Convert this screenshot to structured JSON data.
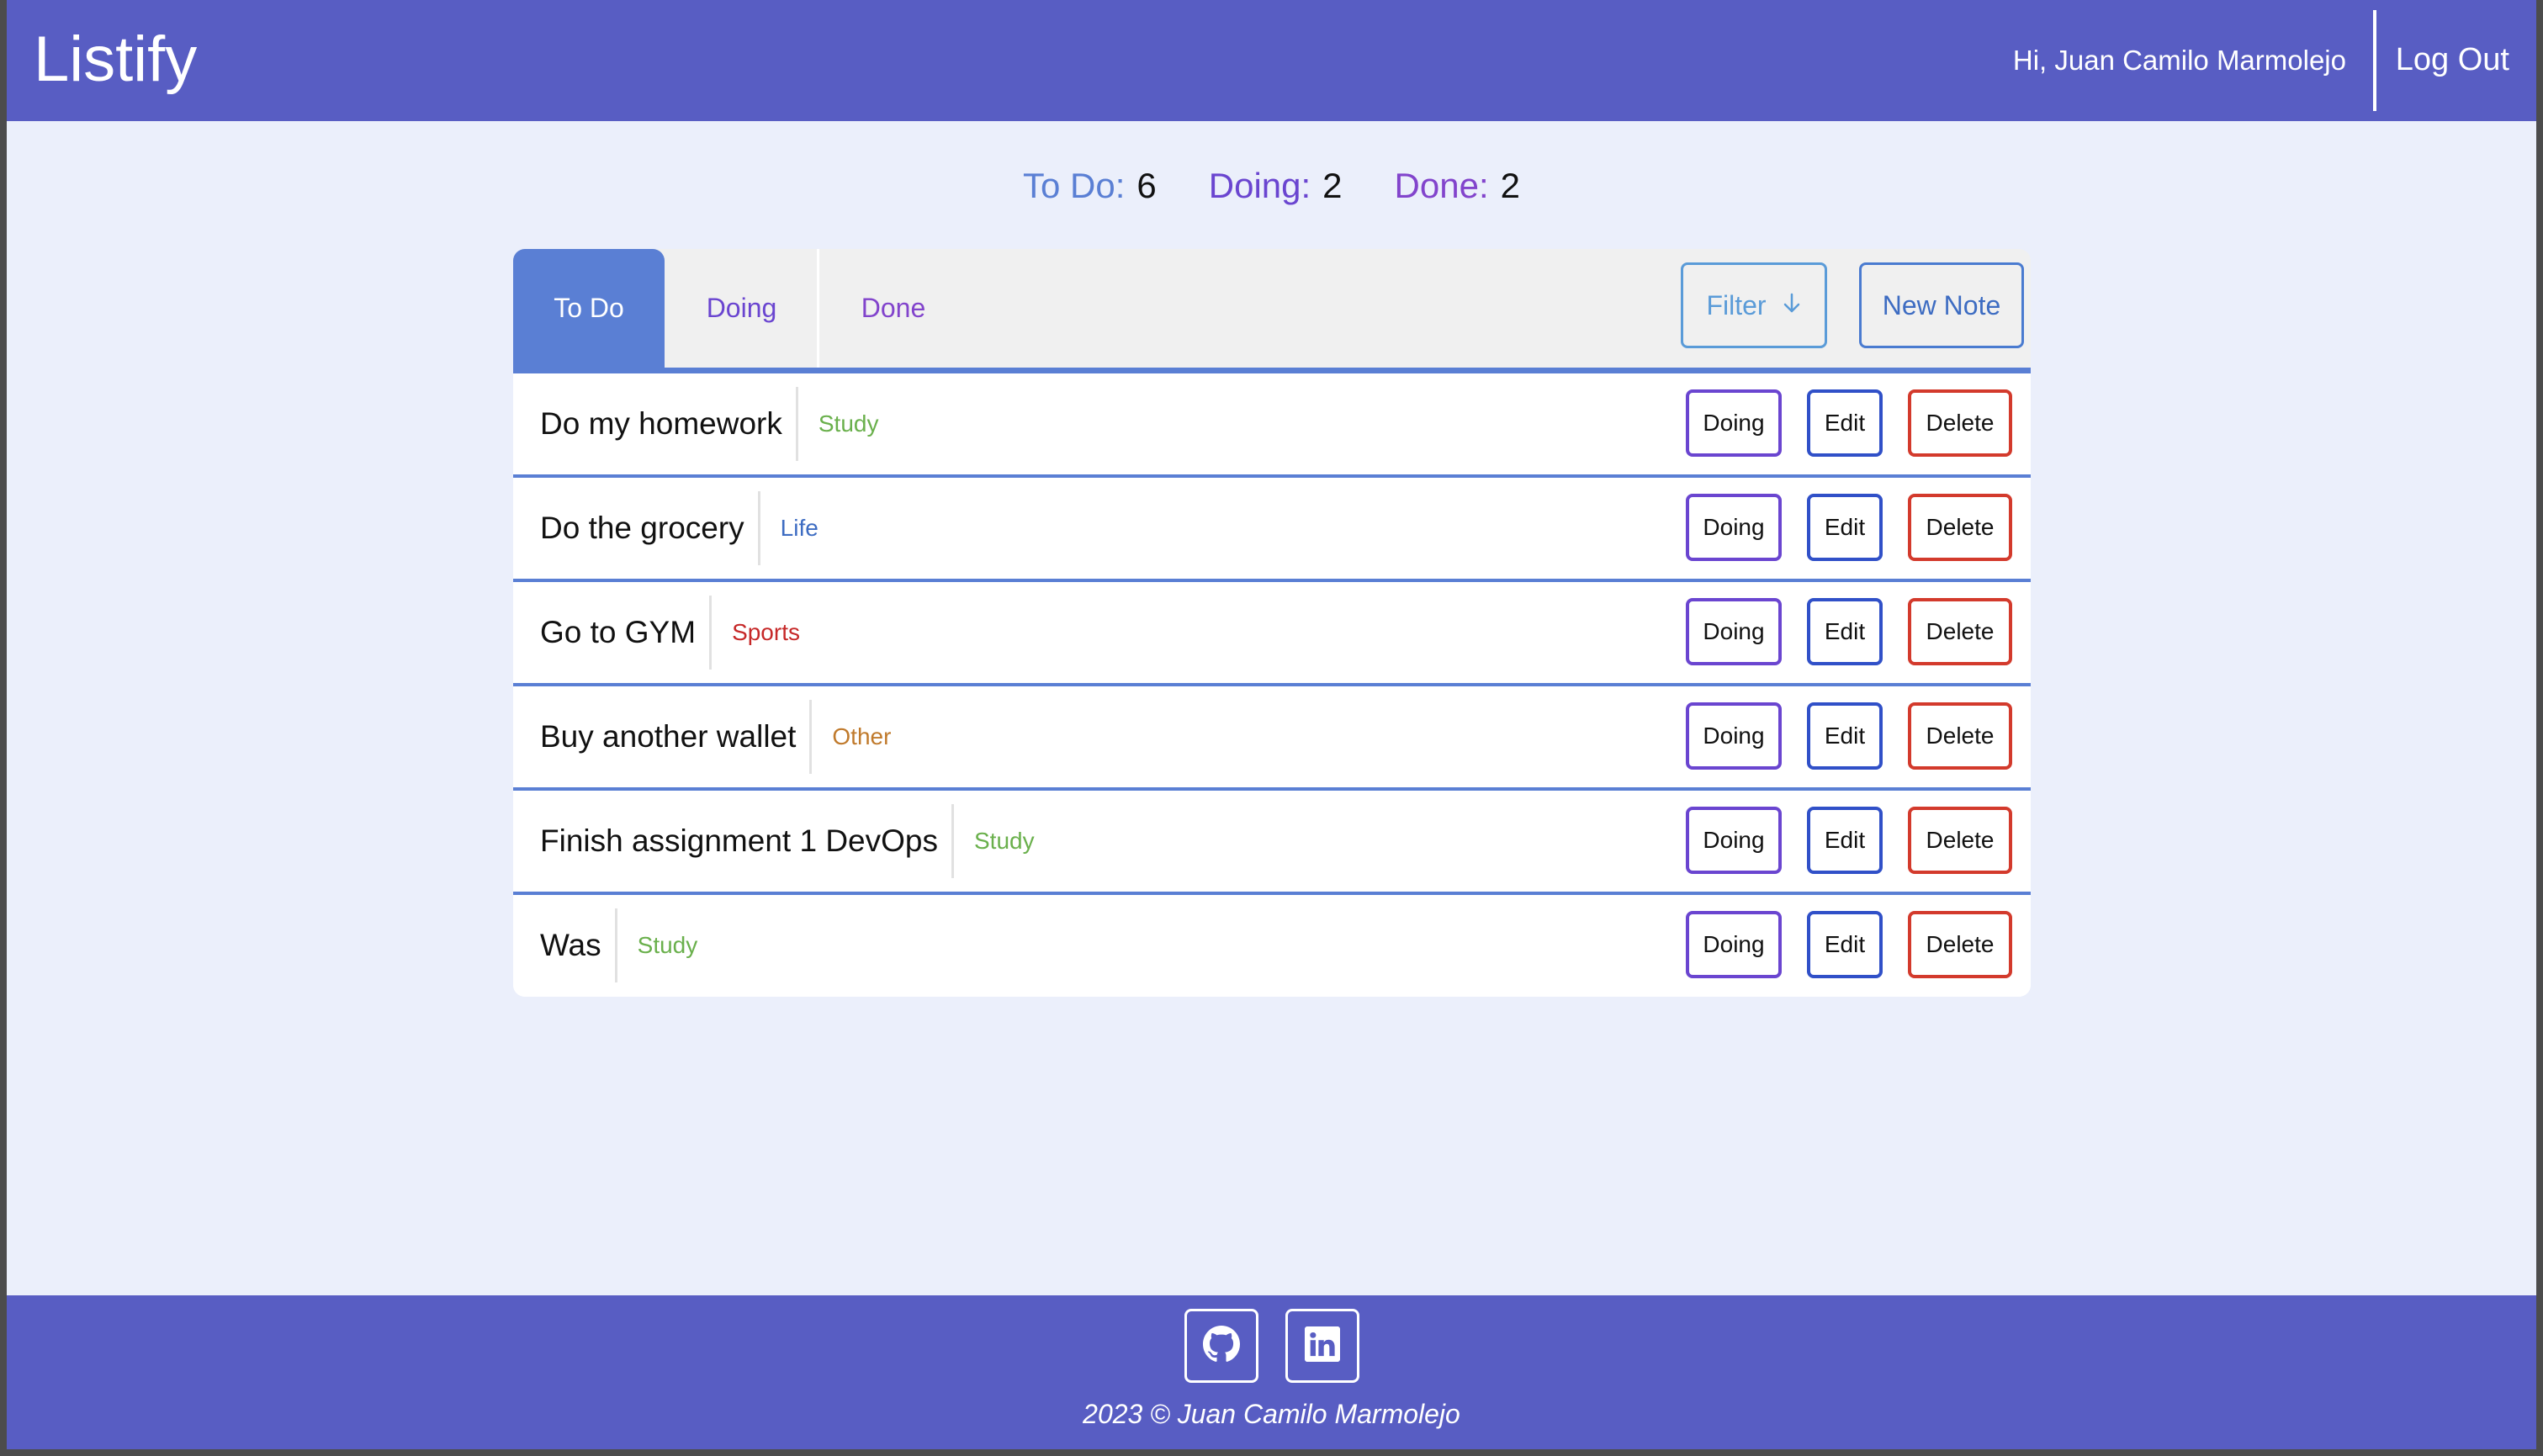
{
  "header": {
    "brand": "Listify",
    "greeting": "Hi, Juan Camilo Marmolejo",
    "logout_label": "Log Out"
  },
  "stats": [
    {
      "label": "To Do:",
      "count": "6"
    },
    {
      "label": "Doing:",
      "count": "2"
    },
    {
      "label": "Done:",
      "count": "2"
    }
  ],
  "tabs": [
    {
      "label": "To Do",
      "active": true
    },
    {
      "label": "Doing",
      "active": false
    },
    {
      "label": "Done",
      "active": false
    }
  ],
  "toolbar": {
    "filter_label": "Filter",
    "new_note_label": "New Note"
  },
  "notes": [
    {
      "title": "Do my homework",
      "category": "Study"
    },
    {
      "title": "Do the grocery",
      "category": "Life"
    },
    {
      "title": "Go to GYM",
      "category": "Sports"
    },
    {
      "title": "Buy another wallet",
      "category": "Other"
    },
    {
      "title": "Finish assignment 1 DevOps",
      "category": "Study"
    },
    {
      "title": "Was",
      "category": "Study"
    }
  ],
  "row_actions": {
    "doing_label": "Doing",
    "edit_label": "Edit",
    "delete_label": "Delete"
  },
  "footer": {
    "github_icon": "github-icon",
    "linkedin_icon": "linkedin-icon",
    "copyright": "2023 © Juan Camilo Marmolejo"
  },
  "colors": {
    "primary": "#585dc3",
    "accent": "#5a7fd4",
    "doing": "#6a45d0",
    "done": "#8244cc",
    "delete": "#d33a2c"
  }
}
